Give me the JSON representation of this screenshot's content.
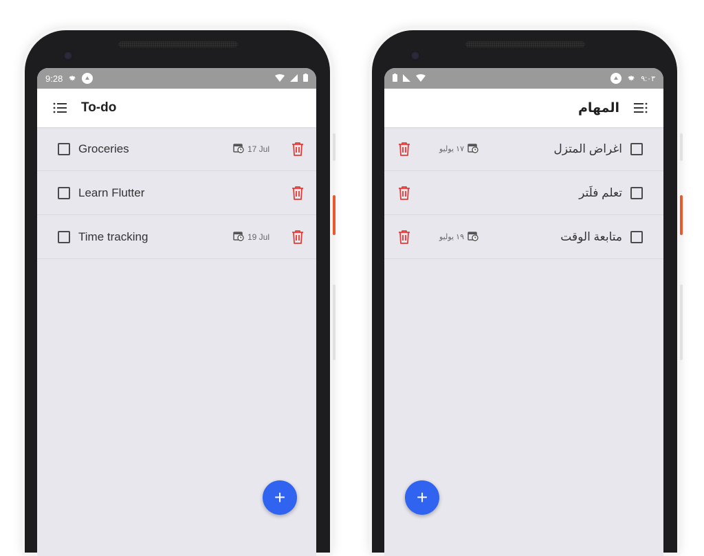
{
  "colors": {
    "accent_blue": "#2f63f0",
    "delete_red": "#e53935",
    "statusbar": "#9a9a9a",
    "screen_bg": "#e8e7ee"
  },
  "ltr": {
    "status": {
      "time": "9:28"
    },
    "appbar": {
      "title": "To-do",
      "menu_icon": "list-icon"
    },
    "items": [
      {
        "label": "Groceries",
        "date": "17 Jul"
      },
      {
        "label": "Learn Flutter",
        "date": ""
      },
      {
        "label": "Time tracking",
        "date": "19 Jul"
      }
    ],
    "fab": {
      "label": "+"
    }
  },
  "rtl": {
    "status": {
      "time": "٩:٠٣"
    },
    "appbar": {
      "title": "المهام",
      "menu_icon": "list-icon"
    },
    "items": [
      {
        "label": "اغراض المتزل",
        "date": "١٧ يوليو"
      },
      {
        "label": "تعلم فلَتر",
        "date": ""
      },
      {
        "label": "متابعة الوقت",
        "date": "١٩ يوليو"
      }
    ],
    "fab": {
      "label": "+"
    }
  }
}
